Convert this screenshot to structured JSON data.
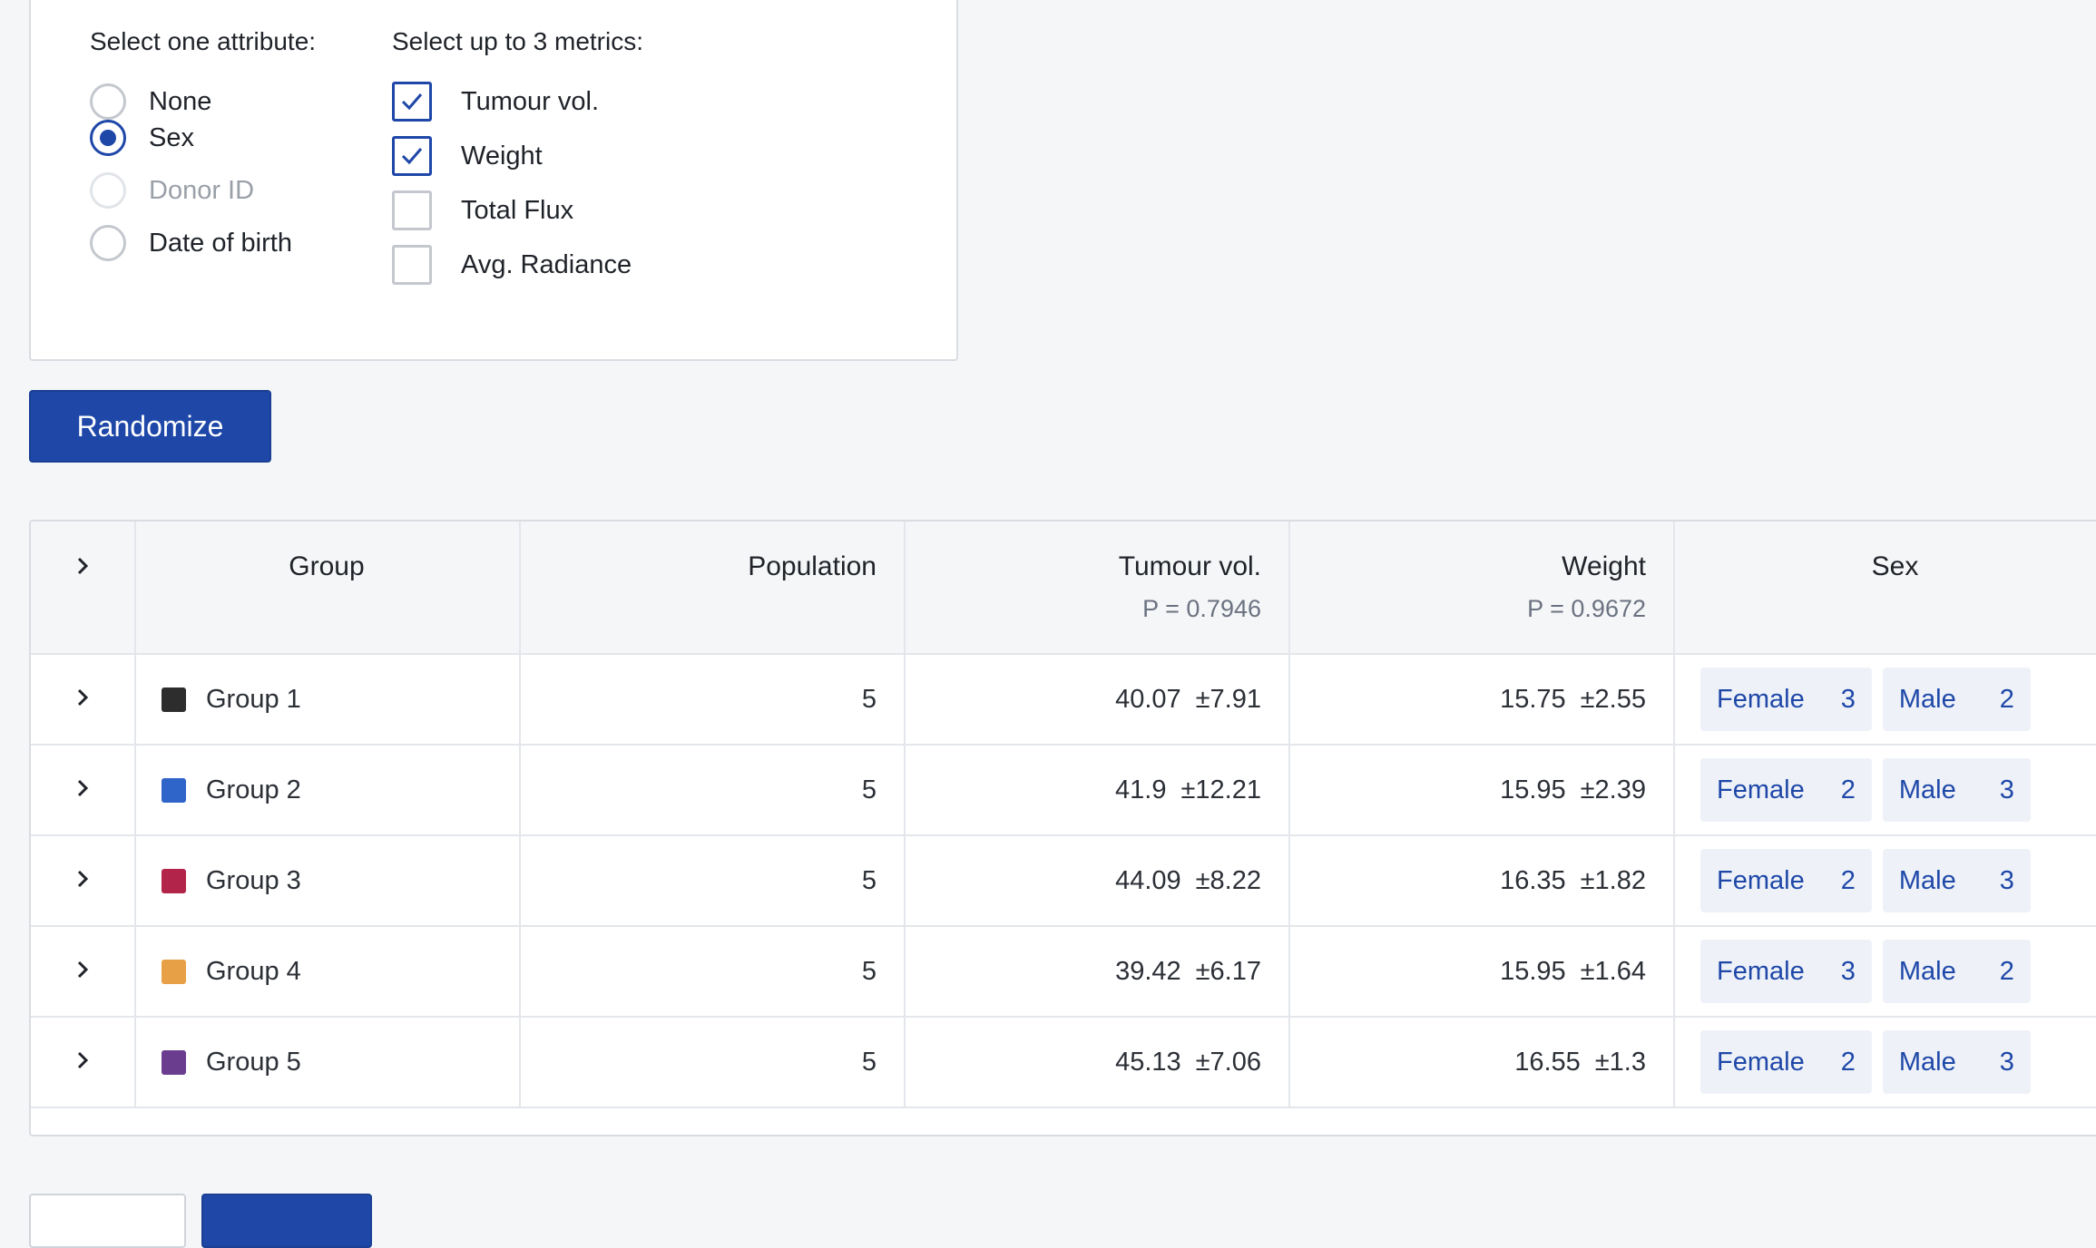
{
  "attributes": {
    "title": "Select one attribute:",
    "options": [
      {
        "label": "None",
        "selected": false,
        "disabled": false
      },
      {
        "label": "Sex",
        "selected": true,
        "disabled": false
      },
      {
        "label": "Donor ID",
        "selected": false,
        "disabled": true
      },
      {
        "label": "Date of birth",
        "selected": false,
        "disabled": false
      }
    ]
  },
  "metrics": {
    "title": "Select up to 3 metrics:",
    "options": [
      {
        "label": "Tumour vol.",
        "checked": true
      },
      {
        "label": "Weight",
        "checked": true
      },
      {
        "label": "Total Flux",
        "checked": false
      },
      {
        "label": "Avg. Radiance",
        "checked": false
      }
    ]
  },
  "randomize_label": "Randomize",
  "colors": {
    "primary": "#1e47a8",
    "tag_bg": "#eef2f8",
    "tag_text": "#1e47a8"
  },
  "table": {
    "headers": {
      "group": "Group",
      "population": "Population",
      "tumour": "Tumour vol.",
      "tumour_p": "P = 0.7946",
      "weight": "Weight",
      "weight_p": "P = 0.9672",
      "sex": "Sex"
    },
    "rows": [
      {
        "name": "Group 1",
        "color": "#2d2d2d",
        "population": "5",
        "tumour": "40.07",
        "tumour_sd": "±7.91",
        "weight": "15.75",
        "weight_sd": "±2.55",
        "female_label": "Female",
        "female": "3",
        "male_label": "Male",
        "male": "2"
      },
      {
        "name": "Group 2",
        "color": "#2f64c9",
        "population": "5",
        "tumour": "41.9",
        "tumour_sd": "±12.21",
        "weight": "15.95",
        "weight_sd": "±2.39",
        "female_label": "Female",
        "female": "2",
        "male_label": "Male",
        "male": "3"
      },
      {
        "name": "Group 3",
        "color": "#b3244a",
        "population": "5",
        "tumour": "44.09",
        "tumour_sd": "±8.22",
        "weight": "16.35",
        "weight_sd": "±1.82",
        "female_label": "Female",
        "female": "2",
        "male_label": "Male",
        "male": "3"
      },
      {
        "name": "Group 4",
        "color": "#e8a046",
        "population": "5",
        "tumour": "39.42",
        "tumour_sd": "±6.17",
        "weight": "15.95",
        "weight_sd": "±1.64",
        "female_label": "Female",
        "female": "3",
        "male_label": "Male",
        "male": "2"
      },
      {
        "name": "Group 5",
        "color": "#6b3d8f",
        "population": "5",
        "tumour": "45.13",
        "tumour_sd": "±7.06",
        "weight": "16.55",
        "weight_sd": "±1.3",
        "female_label": "Female",
        "female": "2",
        "male_label": "Male",
        "male": "3"
      }
    ]
  }
}
